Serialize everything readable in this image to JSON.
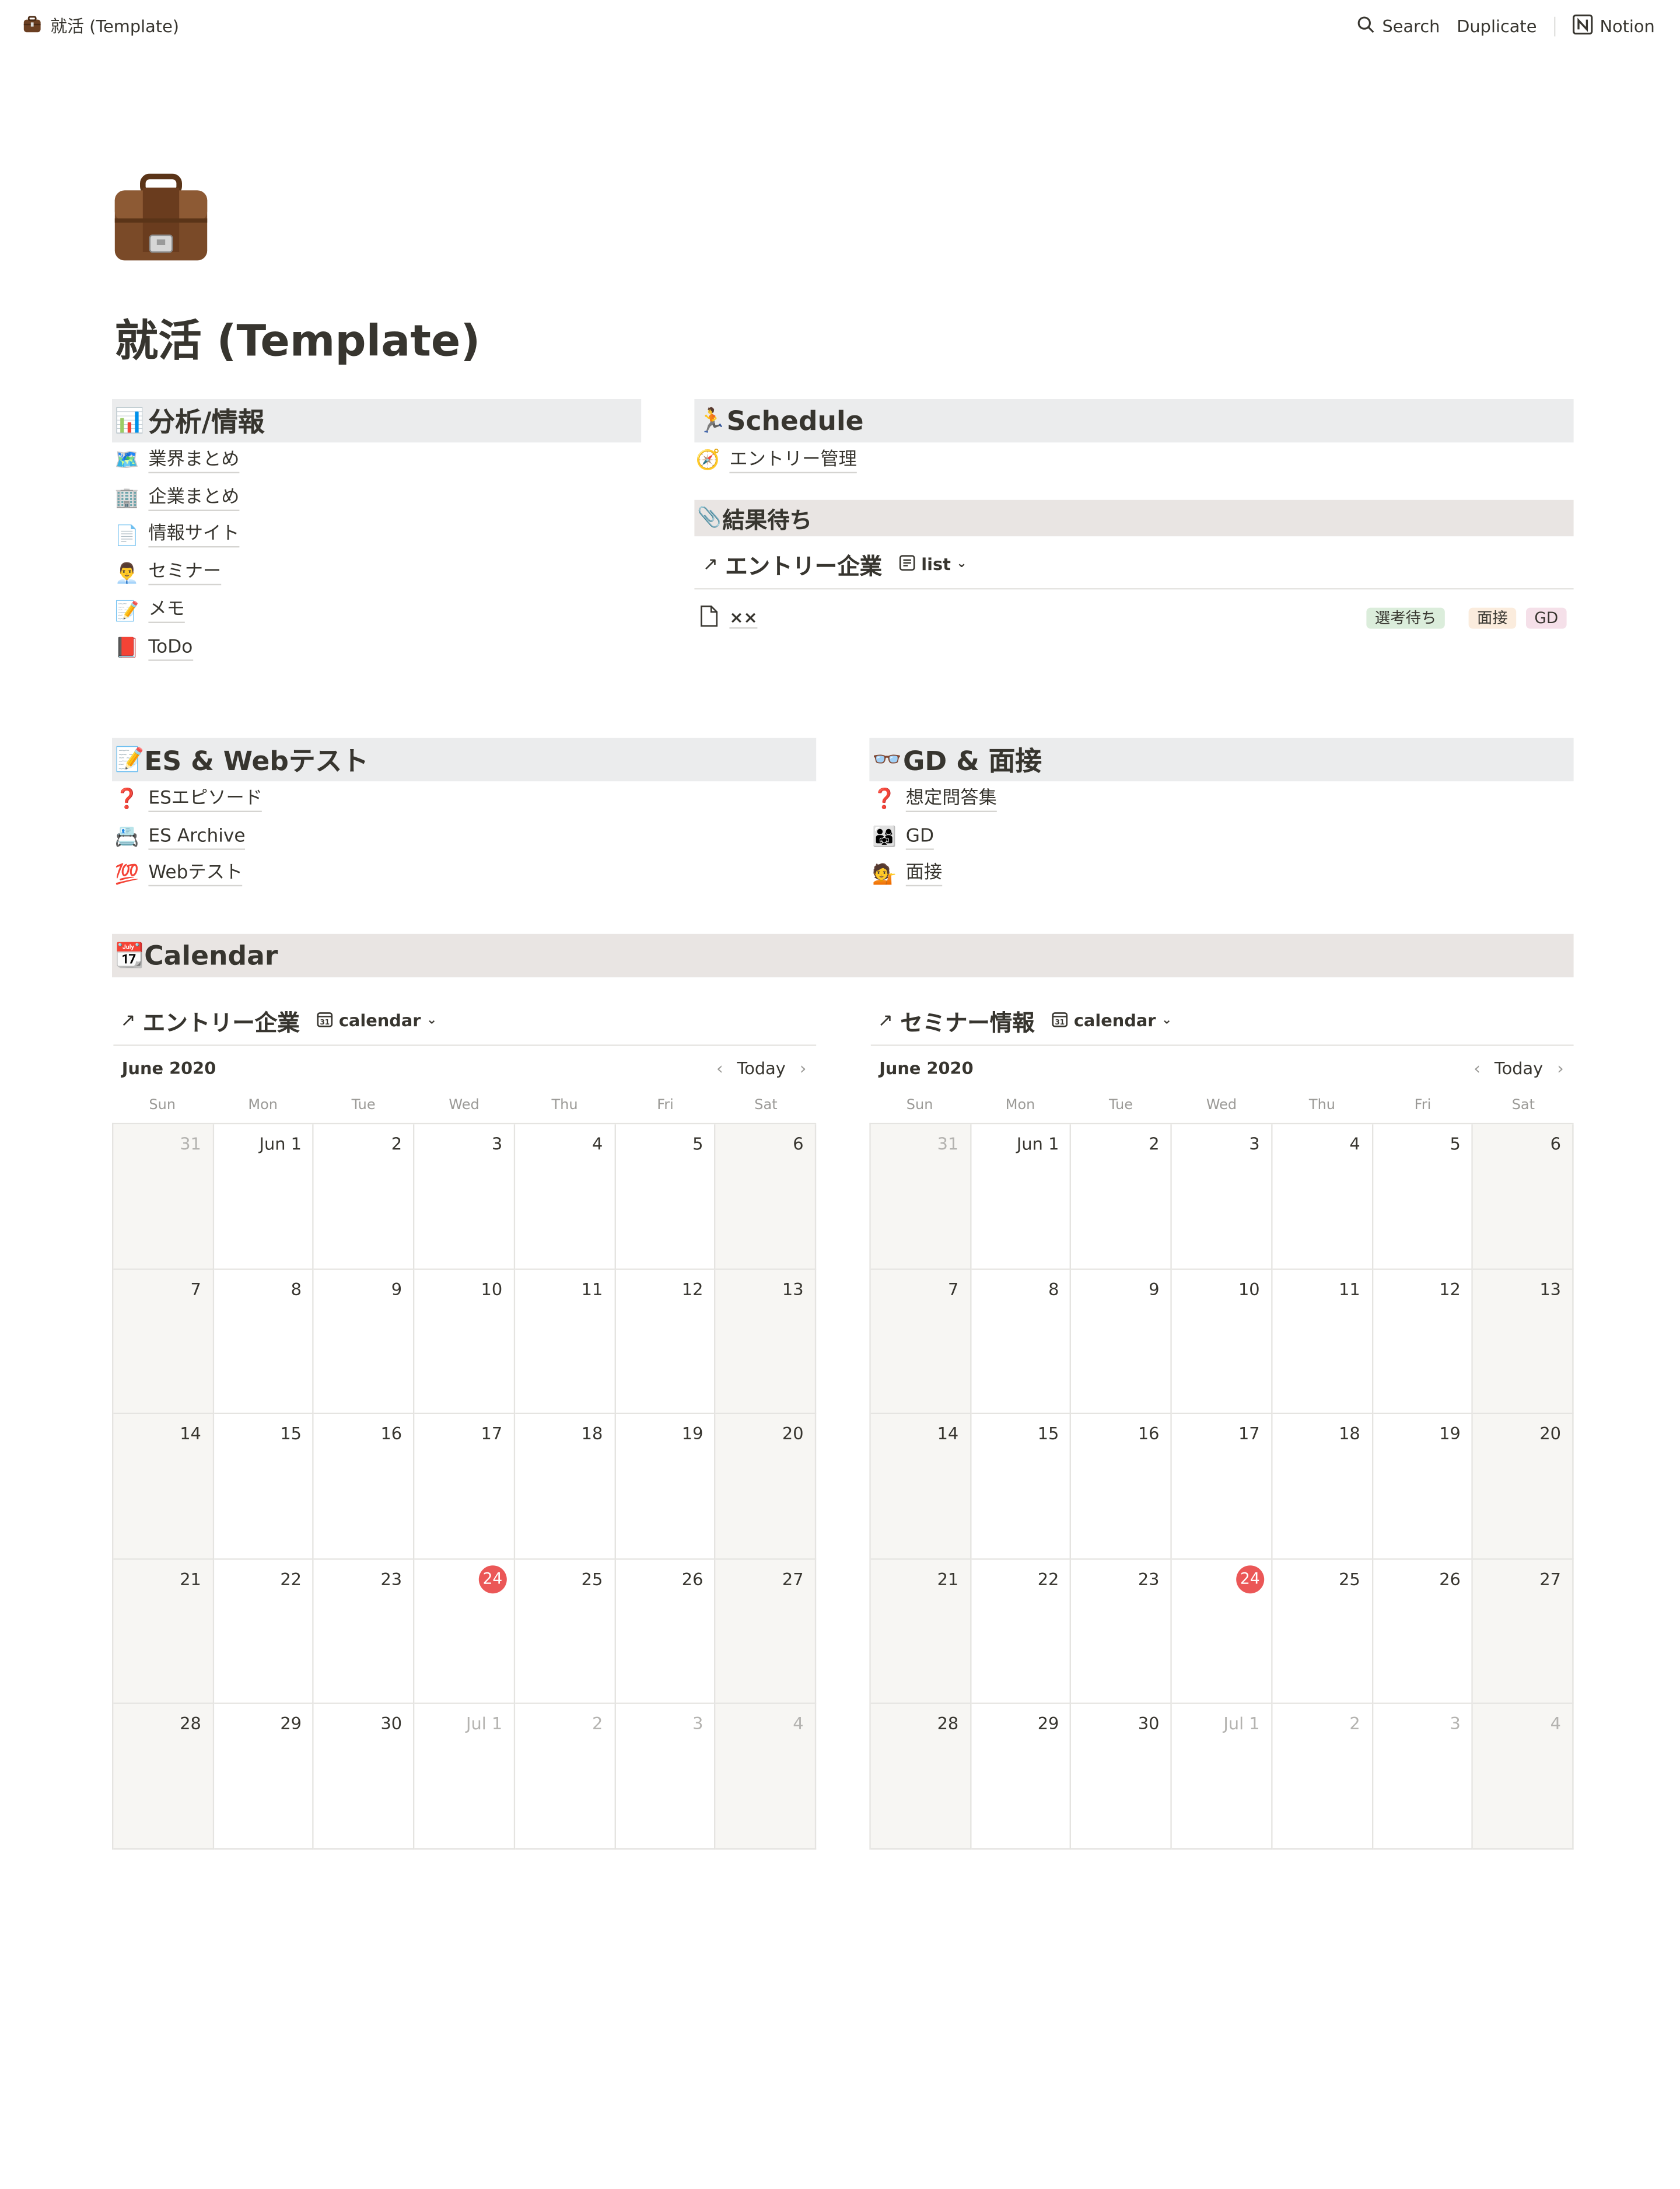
{
  "topbar": {
    "page_label": "就活 (Template)",
    "search": "Search",
    "duplicate": "Duplicate",
    "notion": "Notion"
  },
  "page": {
    "icon": "briefcase-icon",
    "title": "就活 (Template)"
  },
  "analysis": {
    "heading_emoji": "📊",
    "heading": "分析/情報",
    "items": [
      {
        "emoji": "🗺️",
        "label": "業界まとめ"
      },
      {
        "emoji": "🏢",
        "label": "企業まとめ"
      },
      {
        "emoji": "📄",
        "label": "情報サイト"
      },
      {
        "emoji": "👨‍💼",
        "label": "セミナー"
      },
      {
        "emoji": "📝",
        "label": "メモ"
      },
      {
        "emoji": "📕",
        "label": "ToDo"
      }
    ]
  },
  "schedule": {
    "heading_emoji": "🏃",
    "heading": "Schedule",
    "items": [
      {
        "emoji": "🧭",
        "label": "エントリー管理"
      }
    ],
    "waiting": {
      "heading_emoji": "📎",
      "heading": "結果待ち",
      "db_title": "エントリー企業",
      "view": "list",
      "rows": [
        {
          "label": "××",
          "tags": [
            "選考待ち",
            "面接",
            "GD"
          ]
        }
      ],
      "tag_colors": [
        "#dbeddb",
        "#fbecdd",
        "#f5e0e9"
      ]
    }
  },
  "es": {
    "heading_emoji": "📝",
    "heading": "ES & Webテスト",
    "items": [
      {
        "emoji": "❓",
        "label": "ESエピソード"
      },
      {
        "emoji": "📇",
        "label": "ES Archive"
      },
      {
        "emoji": "💯",
        "label": "Webテスト"
      }
    ]
  },
  "gd": {
    "heading_emoji": "👓",
    "heading": "GD & 面接",
    "items": [
      {
        "emoji": "❓",
        "label": "想定問答集"
      },
      {
        "emoji": "👨‍👩‍👧",
        "label": "GD"
      },
      {
        "emoji": "💁",
        "label": "面接"
      }
    ]
  },
  "calendar_section": {
    "heading_emoji": "📆",
    "heading": "Calendar",
    "today_color": "#eb5757",
    "calendars": [
      {
        "db_title": "エントリー企業",
        "view": "calendar",
        "month": "June 2020",
        "today_label": "Today"
      },
      {
        "db_title": "セミナー情報",
        "view": "calendar",
        "month": "June 2020",
        "today_label": "Today"
      }
    ],
    "weekdays": [
      "Sun",
      "Mon",
      "Tue",
      "Wed",
      "Thu",
      "Fri",
      "Sat"
    ],
    "weeks": [
      [
        "31",
        "Jun 1",
        "2",
        "3",
        "4",
        "5",
        "6"
      ],
      [
        "7",
        "8",
        "9",
        "10",
        "11",
        "12",
        "13"
      ],
      [
        "14",
        "15",
        "16",
        "17",
        "18",
        "19",
        "20"
      ],
      [
        "21",
        "22",
        "23",
        "24",
        "25",
        "26",
        "27"
      ],
      [
        "28",
        "29",
        "30",
        "Jul 1",
        "2",
        "3",
        "4"
      ]
    ],
    "dim_cells": [
      "0-0",
      "4-3",
      "4-4",
      "4-5",
      "4-6"
    ],
    "today_cell": "3-3"
  }
}
